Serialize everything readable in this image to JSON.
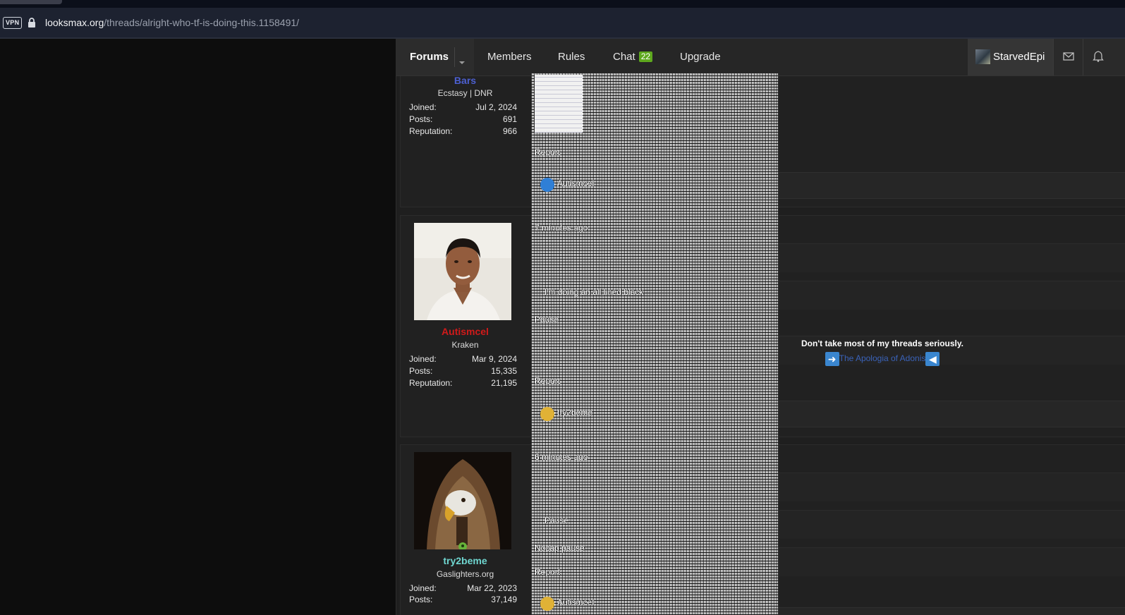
{
  "browser": {
    "vpn_label": "VPN",
    "url_host": "looksmax.org",
    "url_path": "/threads/alright-who-tf-is-doing-this.1158491/"
  },
  "nav": {
    "forums": "Forums",
    "members": "Members",
    "rules": "Rules",
    "chat": "Chat",
    "chat_count": "22",
    "upgrade": "Upgrade",
    "username": "StarvedEpi"
  },
  "posts": [
    {
      "username": "Bars",
      "user_title": "Ecstasy | DNR",
      "name_color": "#4c5fd0",
      "stats": [
        {
          "label": "Joined:",
          "value": "Jul 2, 2024"
        },
        {
          "label": "Posts:",
          "value": "691"
        },
        {
          "label": "Reputation:",
          "value": "966"
        }
      ],
      "report": "Report",
      "reaction_by": "Autismcel"
    },
    {
      "username": "Autismcel",
      "user_title": "Kraken",
      "name_color": "#d11a1a",
      "stats": [
        {
          "label": "Joined:",
          "value": "Mar 9, 2024"
        },
        {
          "label": "Posts:",
          "value": "15,335"
        },
        {
          "label": "Reputation:",
          "value": "21,195"
        }
      ],
      "time": "7 minutes ago",
      "quote_line": "I'm doing an all lined black",
      "body": "Pause",
      "report": "Report",
      "reaction_by": "try2beme",
      "signature_title": "Don't take most of my threads seriously.",
      "signature_link": "The Apologia of Adonis"
    },
    {
      "username": "try2beme",
      "user_title": "Gaslighters.org",
      "name_color": "#6fd6d0",
      "stats": [
        {
          "label": "Joined:",
          "value": "Mar 22, 2023"
        },
        {
          "label": "Posts:",
          "value": "37,149"
        }
      ],
      "time": "6 minutes ago",
      "quote_line": "Pause",
      "body": "Nocap pause",
      "report": "Report",
      "reaction_by": "Autismcel"
    }
  ],
  "colors": {
    "chat_badge": "#5ea81e",
    "signature_link": "#3a62b8",
    "arrow_box": "#3a86cf"
  }
}
